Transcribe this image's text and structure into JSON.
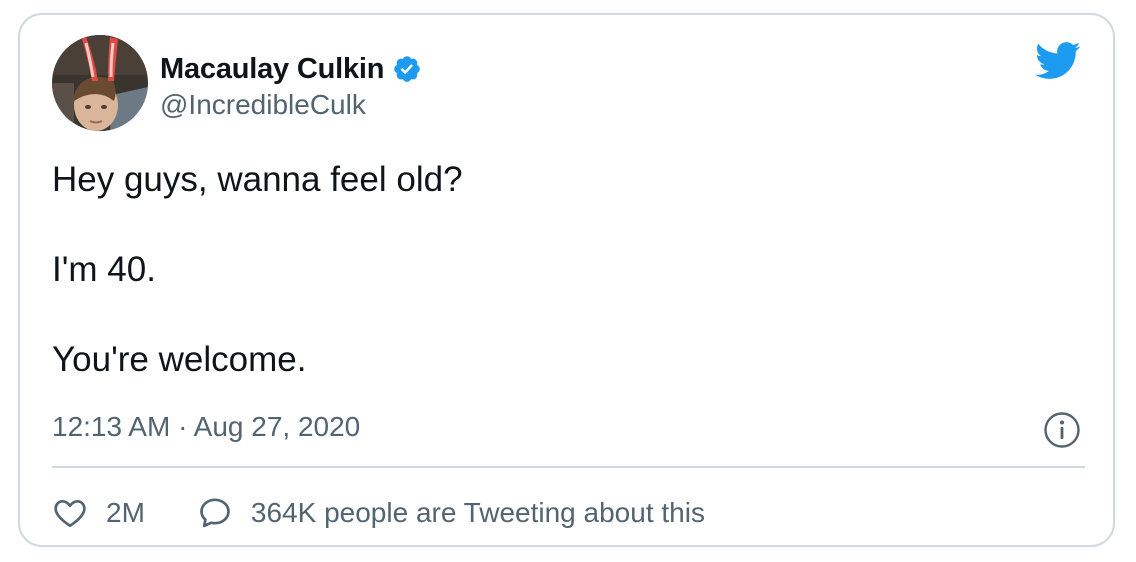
{
  "author": {
    "display_name": "Macaulay Culkin",
    "handle": "@IncredibleCulk",
    "verified": true
  },
  "tweet": {
    "lines": [
      "Hey guys, wanna feel old?",
      "",
      "I'm 40.",
      "",
      "You're welcome."
    ],
    "timestamp": "12:13 AM · Aug 27, 2020"
  },
  "actions": {
    "likes": "2M",
    "conversation": "364K people are Tweeting about this"
  },
  "icons": {
    "logo": "twitter-bird-icon",
    "verified": "verified-badge-icon",
    "info": "info-icon",
    "like": "heart-icon",
    "reply": "speech-bubble-icon"
  },
  "colors": {
    "brand": "#1d9bf0",
    "text": "#0f1419",
    "secondary": "#536471",
    "border": "#cfd9de"
  }
}
